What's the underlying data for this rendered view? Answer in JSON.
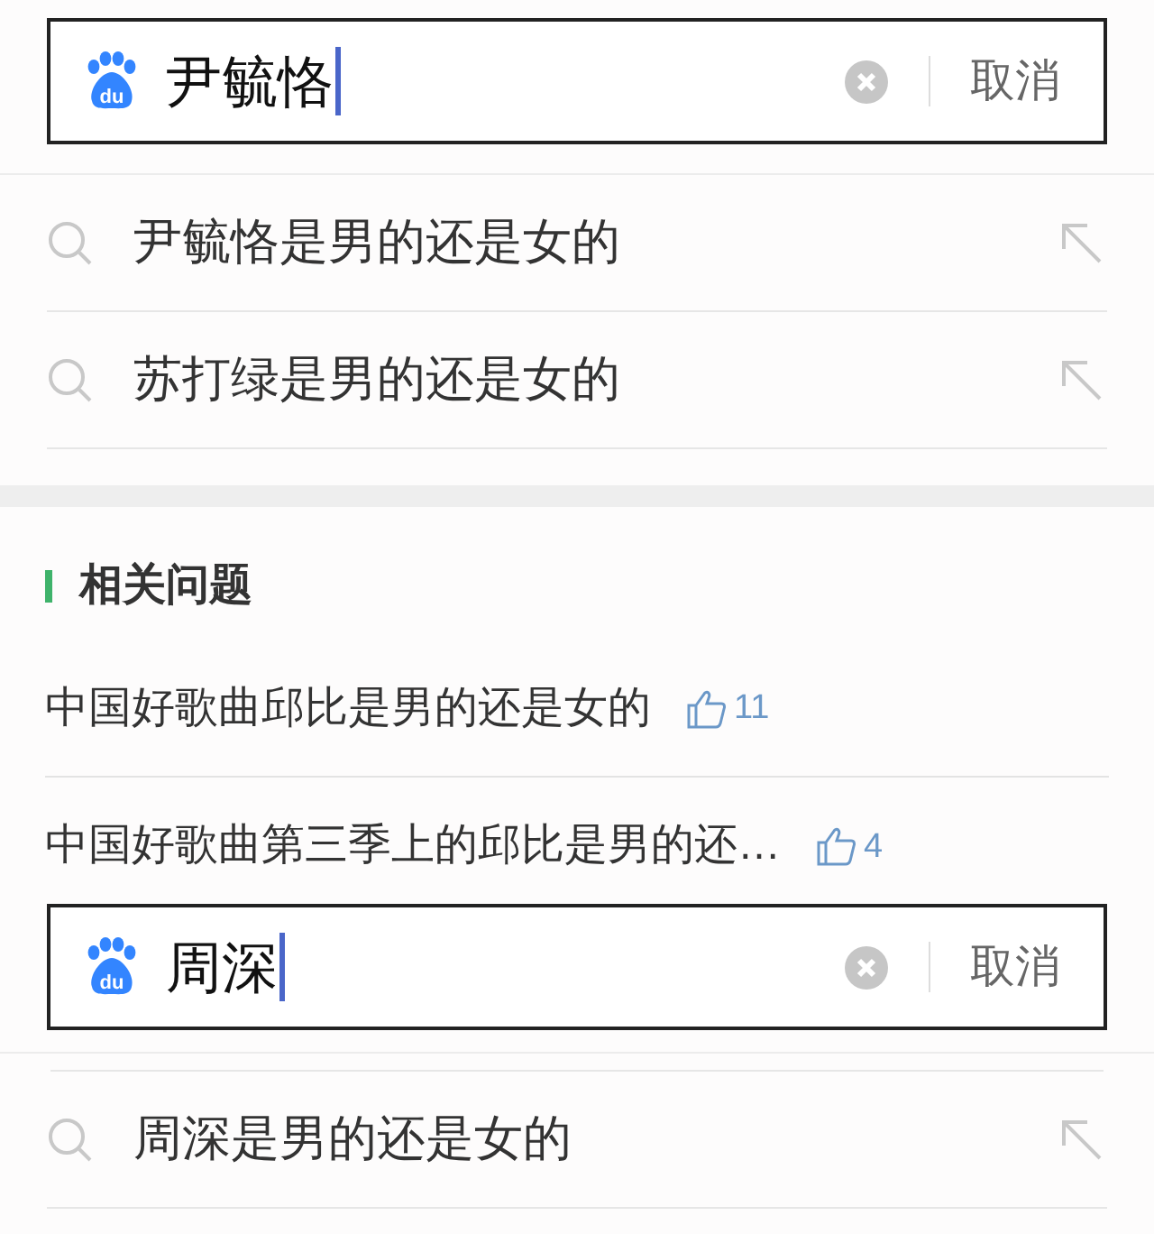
{
  "search_1": {
    "logo": "du",
    "value": "尹毓恪",
    "cancel": "取消"
  },
  "suggestions_1": [
    {
      "text": "尹毓恪是男的还是女的"
    },
    {
      "text": "苏打绿是男的还是女的"
    }
  ],
  "related": {
    "title": "相关问题",
    "items": [
      {
        "text": "中国好歌曲邱比是男的还是女的",
        "likes": "11"
      },
      {
        "text": "中国好歌曲第三季上的邱比是男的还…",
        "likes": "4"
      }
    ]
  },
  "search_2": {
    "logo": "du",
    "value": "周深",
    "cancel": "取消"
  },
  "suggestions_2": [
    {
      "text": "周深是男的还是女的"
    }
  ]
}
